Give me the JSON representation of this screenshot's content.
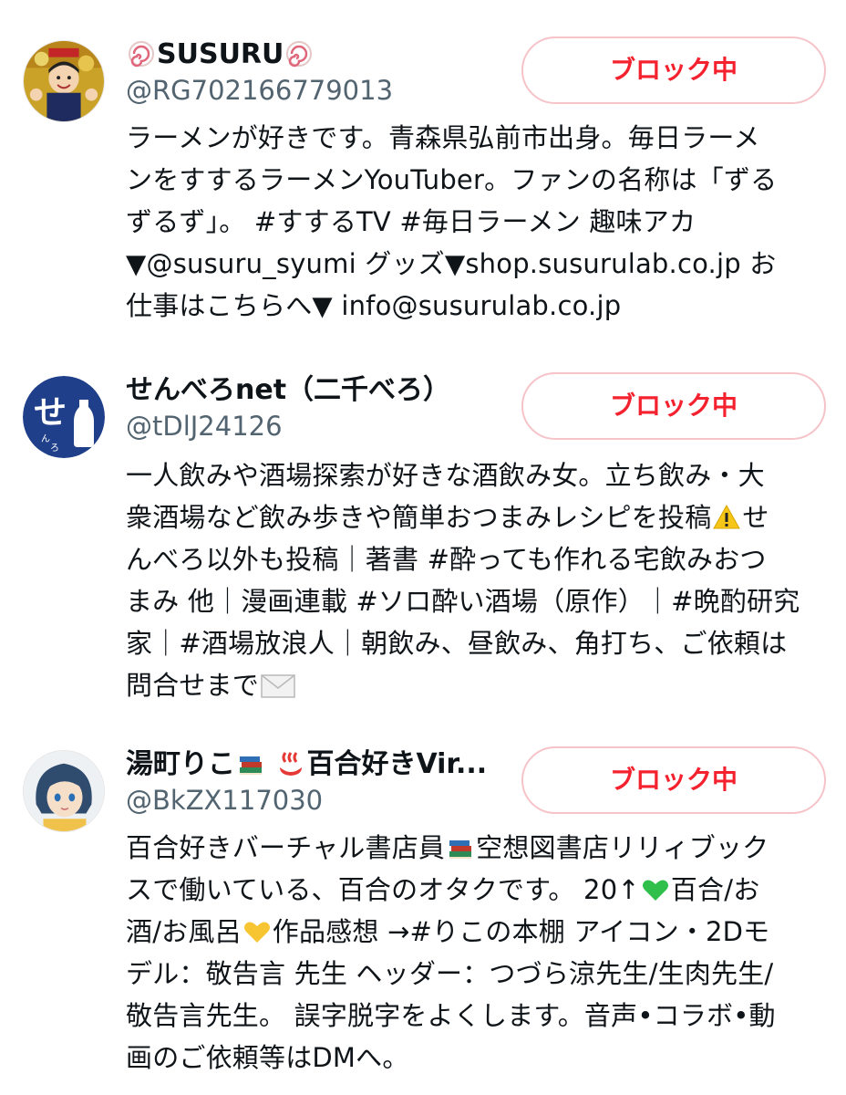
{
  "users": [
    {
      "name_prefix_icon": "naruto-fishcake-icon",
      "name": "SUSURU",
      "name_suffix_icon": "naruto-fishcake-icon",
      "handle": "@RG702166779013",
      "button_label": "ブロック中",
      "bio_lines": [
        "ラーメンが好きです。青森県弘前市出身。毎日ラーメ",
        "ンをすするラーメンYouTuber。ファンの名称は「ずる",
        "ずるず」。 #すするTV #毎日ラーメン 趣味アカ",
        "▼@susuru_syumi グッズ▼shop.susurulab.co.jp お",
        "仕事はこちらへ▼ info@susurulab.co.jp"
      ]
    },
    {
      "name": "せんべろnet（二千べろ）",
      "handle": "@tDlJ24126",
      "button_label": "ブロック中",
      "avatar_text": "せ",
      "bio_lines": [
        "一人飲みや酒場探索が好きな酒飲み女。立ち飲み・大",
        "衆酒場など飲み歩きや簡単おつまみレシピを投稿",
        "んべろ以外も投稿｜著書 #酔っても作れる宅飲みおつ",
        "まみ 他｜漫画連載 #ソロ酔い酒場（原作）｜#晩酌研究",
        "家｜#酒場放浪人｜朝飲み、昼飲み、角打ち、ご依頼は",
        "問合せまで"
      ],
      "bio_line2_suffix": "せ",
      "warning_icon": "warning-icon",
      "mail_icon": "envelope-icon"
    },
    {
      "name_part1": "湯町りこ",
      "name_part2": "百合好きVir...",
      "handle": "@BkZX117030",
      "button_label": "ブロック中",
      "bio_lines": [
        "百合好きバーチャル書店員",
        "空想図書店リリィブック",
        "スで働いている、百合のオタクです。 20↑",
        "百合/お",
        "酒/お風呂",
        "作品感想 →#りこの本棚 アイコン・2Dモ",
        "デル：敬告言 先生 ヘッダー：つづら涼先生/生肉先生/",
        "敬告言先生。 誤字脱字をよくします。音声•コラボ•動",
        "画のご依頼等はDMへ。"
      ],
      "icons": {
        "books": "books-icon",
        "hot_springs": "hot-springs-icon",
        "green_heart": "green-heart-icon",
        "yellow_heart": "yellow-heart-icon"
      },
      "colors": {
        "green_heart": "#2fbf4a",
        "yellow_heart": "#f7c531"
      }
    }
  ],
  "colors": {
    "block_text": "#f4212e",
    "block_border": "#f6c3c8",
    "handle": "#536471",
    "text": "#0f1419"
  }
}
